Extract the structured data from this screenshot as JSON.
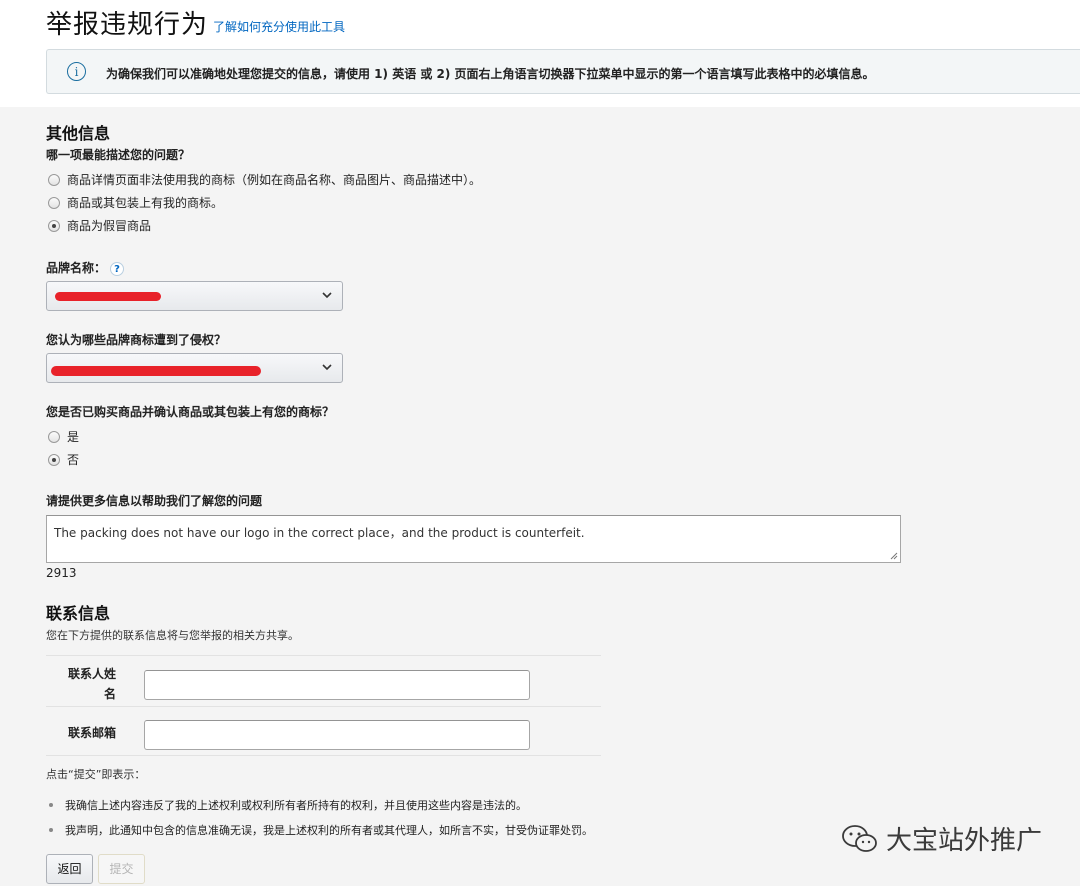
{
  "header": {
    "title": "举报违规行为",
    "help_link": "了解如何充分使用此工具",
    "info_text": "为确保我们可以准确地处理您提交的信息，请使用 1) 英语 或 2) 页面右上角语言切换器下拉菜单中显示的第一个语言填写此表格中的必填信息。",
    "info_icon": "i"
  },
  "other_info": {
    "heading": "其他信息",
    "question": "哪一项最能描述您的问题？",
    "options": [
      {
        "label": "商品详情页面非法使用我的商标（例如在商品名称、商品图片、商品描述中）。",
        "checked": false
      },
      {
        "label": "商品或其包装上有我的商标。",
        "checked": false
      },
      {
        "label": "商品为假冒商品",
        "checked": true
      }
    ],
    "brand_label": "品牌名称：",
    "brand_help": "?",
    "trademark_label": "您认为哪些品牌商标遭到了侵权？",
    "purchase_question": "您是否已购买商品并确认商品或其包装上有您的商标？",
    "purchase_options": [
      {
        "label": "是",
        "checked": false
      },
      {
        "label": "否",
        "checked": true
      }
    ],
    "details_label": "请提供更多信息以帮助我们了解您的问题",
    "details_value": "The packing does not have our logo in the correct place，and the product is counterfeit.",
    "char_count": "2913"
  },
  "contact": {
    "heading": "联系信息",
    "subtitle": "您在下方提供的联系信息将与您举报的相关方共享。",
    "name_label_1": "联系人姓",
    "name_label_2": "名",
    "email_label": "联系邮箱",
    "name_value": "",
    "email_value": ""
  },
  "agreement": {
    "intro": "点击“提交”即表示：",
    "items": [
      "我确信上述内容违反了我的上述权利或权利所有者所持有的权利，并且使用这些内容是违法的。",
      "我声明，此通知中包含的信息准确无误，我是上述权利的所有者或其代理人，如所言不实，甘受伪证罪处罚。"
    ]
  },
  "buttons": {
    "back": "返回",
    "submit": "提交"
  },
  "watermark": {
    "text": "大宝站外推广",
    "icon": "wechat-icon"
  },
  "colors": {
    "link": "#0066c0",
    "redaction": "#e8222a"
  }
}
